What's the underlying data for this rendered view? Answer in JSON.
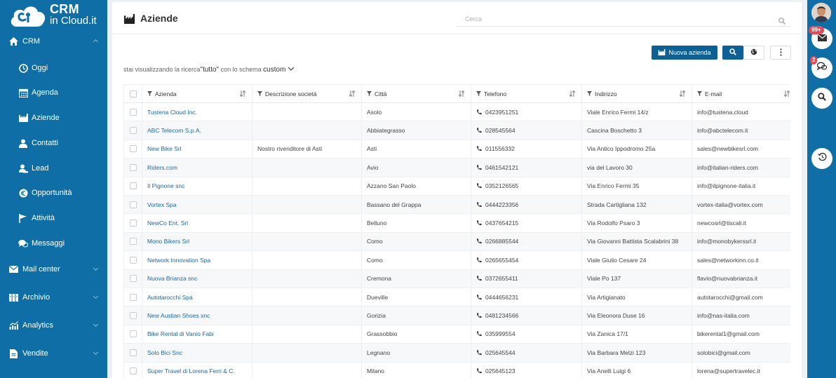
{
  "brand": {
    "line1": "CRM",
    "line2": "in Cloud.it"
  },
  "colors": {
    "sidebar": "#0e6ea5",
    "primary_button": "#0e5f93",
    "link": "#1a67a3",
    "badge": "#e24b5a"
  },
  "sidebar": {
    "items": [
      {
        "label": "CRM",
        "icon": "home-icon",
        "level": "top",
        "expanded": true
      },
      {
        "label": "Oggi",
        "icon": "clock-icon",
        "level": "sub"
      },
      {
        "label": "Agenda",
        "icon": "calendar-icon",
        "level": "sub"
      },
      {
        "label": "Aziende",
        "icon": "factory-icon",
        "level": "sub"
      },
      {
        "label": "Contatti",
        "icon": "person-icon",
        "level": "sub"
      },
      {
        "label": "Lead",
        "icon": "lead-icon",
        "level": "sub"
      },
      {
        "label": "Opportunità",
        "icon": "euro-icon",
        "level": "sub"
      },
      {
        "label": "Attività",
        "icon": "flag-icon",
        "level": "sub"
      },
      {
        "label": "Messaggi",
        "icon": "chat-icon",
        "level": "sub"
      },
      {
        "label": "Mail center",
        "icon": "mail-icon",
        "level": "top",
        "expanded": false
      },
      {
        "label": "Archivio",
        "icon": "archive-icon",
        "level": "top",
        "expanded": false
      },
      {
        "label": "Analytics",
        "icon": "analytics-icon",
        "level": "top",
        "expanded": false
      },
      {
        "label": "Vendite",
        "icon": "document-icon",
        "level": "top",
        "expanded": false
      }
    ]
  },
  "right_rail": {
    "mail_badge": "99+",
    "chat_badge": "2"
  },
  "header": {
    "title": "Aziende",
    "search_placeholder": "Cerca"
  },
  "toolbar": {
    "new_label": "Nuova azienda"
  },
  "view_info": {
    "prefix": "stai visualizzando la ricerca",
    "search_value": "\"tutto\"",
    "middle": "con lo schema",
    "schema_value": "custom"
  },
  "table": {
    "columns": [
      {
        "label": "Azienda",
        "sortable": true
      },
      {
        "label": "Descrizione società",
        "sortable": true
      },
      {
        "label": "Città",
        "sortable": true
      },
      {
        "label": "Telefono",
        "sortable": true
      },
      {
        "label": "Indirizzo",
        "sortable": true
      },
      {
        "label": "E-mail",
        "sortable": true
      }
    ],
    "rows": [
      {
        "azienda": "Tustena Cloud Inc.",
        "descrizione": "",
        "citta": "Asolo",
        "telefono": "0423951251",
        "indirizzo": "Viale Enrico Fermi 14/z",
        "email": "info@tustena.cloud"
      },
      {
        "azienda": "ABC Telecom S.p.A.",
        "descrizione": "",
        "citta": "Abbiategrasso",
        "telefono": "028545564",
        "indirizzo": "Cascina Boschetto 3",
        "email": "info@abctelecom.it"
      },
      {
        "azienda": "New Bike Srl",
        "descrizione": "Nostro rivenditore di Asti",
        "citta": "Asti",
        "telefono": "011556332",
        "indirizzo": "Via Antico Ippodromo 25a",
        "email": "sales@newbikesrl.com"
      },
      {
        "azienda": "Riders.com",
        "descrizione": "",
        "citta": "Avio",
        "telefono": "0461542121",
        "indirizzo": "via del Lavoro 30",
        "email": "info@italian-riders.com"
      },
      {
        "azienda": "Il Pignone snc",
        "descrizione": "",
        "citta": "Azzano San Paolo",
        "telefono": "0352126565",
        "indirizzo": "Via Enrico Fermi 35",
        "email": "info@ilpignone-italia.it"
      },
      {
        "azienda": "Vortex Spa",
        "descrizione": "",
        "citta": "Bassano del Grappa",
        "telefono": "0444223356",
        "indirizzo": "Strada Cartigliana 132",
        "email": "vortex-italia@vortex.com"
      },
      {
        "azienda": "NewCo Ent. Srl",
        "descrizione": "",
        "citta": "Belluno",
        "telefono": "0437654215",
        "indirizzo": "Via Rodolfo Psaro 3",
        "email": "newcosrl@tiscali.it"
      },
      {
        "azienda": "Mono Bikers Srl",
        "descrizione": "",
        "citta": "Como",
        "telefono": "0266885544",
        "indirizzo": "Via Giovanni Battista Scalabrini 38",
        "email": "info@monobykerssrl.it"
      },
      {
        "azienda": "Network Innovation Spa",
        "descrizione": "",
        "citta": "Como",
        "telefono": "0265655454",
        "indirizzo": "Viale Giulio Cesare 24",
        "email": "sales@networkinn.co.it"
      },
      {
        "azienda": "Nuova Brianza snc",
        "descrizione": "",
        "citta": "Cremona",
        "telefono": "0372655411",
        "indirizzo": "Viale Po 137",
        "email": "flavio@nuovabrianza.it"
      },
      {
        "azienda": "Autotarocchi Spa",
        "descrizione": "",
        "citta": "Dueville",
        "telefono": "0444656231",
        "indirizzo": "Via Artigianato",
        "email": "autotarocchi@gmail.com"
      },
      {
        "azienda": "New Austian Shoes snc",
        "descrizione": "",
        "citta": "Gorizia",
        "telefono": "0481234566",
        "indirizzo": "Via Eleonora Duse 16",
        "email": "info@nas-italia.com"
      },
      {
        "azienda": "Bike Rental di Vanio Fabi",
        "descrizione": "",
        "citta": "Grassobbio",
        "telefono": "035999554",
        "indirizzo": "Via Zanica 17/1",
        "email": "bikerental1@gmail.com"
      },
      {
        "azienda": "Solo Bici Snc",
        "descrizione": "",
        "citta": "Legnano",
        "telefono": "025645544",
        "indirizzo": "Via Barbara Melzi 123",
        "email": "solobici@gmail.com"
      },
      {
        "azienda": "Super Travel di Lorena Ferri & C.",
        "descrizione": "",
        "citta": "Milano",
        "telefono": "025645123",
        "indirizzo": "Via Anelli Luigi 6",
        "email": "lorena@supertravelec.it"
      }
    ]
  }
}
